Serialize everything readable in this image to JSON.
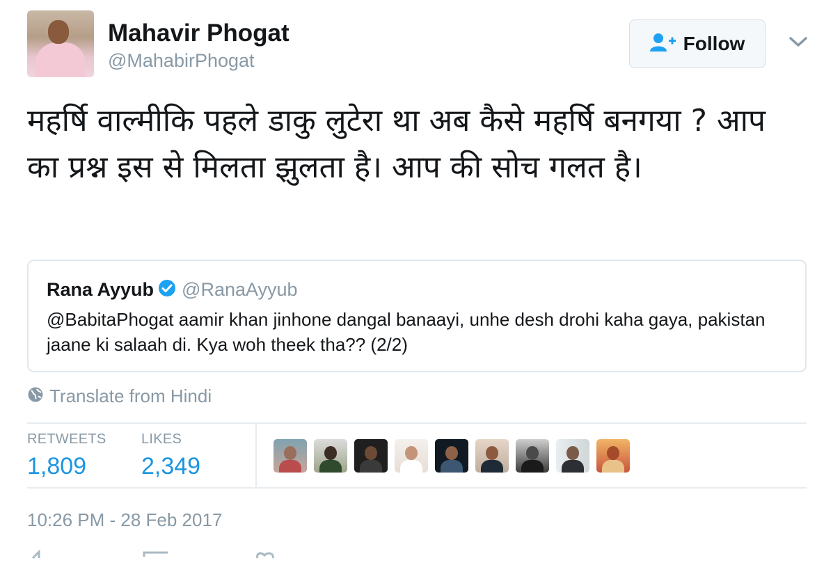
{
  "author": {
    "name": "Mahavir Phogat",
    "handle": "@MahabirPhogat"
  },
  "follow_button": {
    "label": "Follow"
  },
  "tweet": {
    "text": "महर्षि वाल्मीकि पहले डाकु लुटेरा था अब कैसे महर्षि बनगया ? आप का प्रश्न इस से मिलता झुलता है। आप की सोच गलत है।"
  },
  "quoted_tweet": {
    "name": "Rana Ayyub",
    "handle": "@RanaAyyub",
    "text": "@BabitaPhogat aamir khan jinhone dangal banaayi, unhe desh drohi kaha gaya, pakistan jaane ki salaah di. Kya woh theek tha?? (2/2)"
  },
  "translate": {
    "label": "Translate from Hindi"
  },
  "stats": {
    "retweets_label": "RETWEETS",
    "retweets_value": "1,809",
    "likes_label": "LIKES",
    "likes_value": "2,349"
  },
  "timestamp": "10:26 PM - 28 Feb 2017",
  "colors": {
    "accent": "#1b95e0",
    "muted": "#8899a6",
    "verified": "#1da1f2"
  },
  "icons": [
    "follow-user-icon",
    "chevron-down-icon",
    "verified-badge-icon",
    "globe-icon"
  ]
}
